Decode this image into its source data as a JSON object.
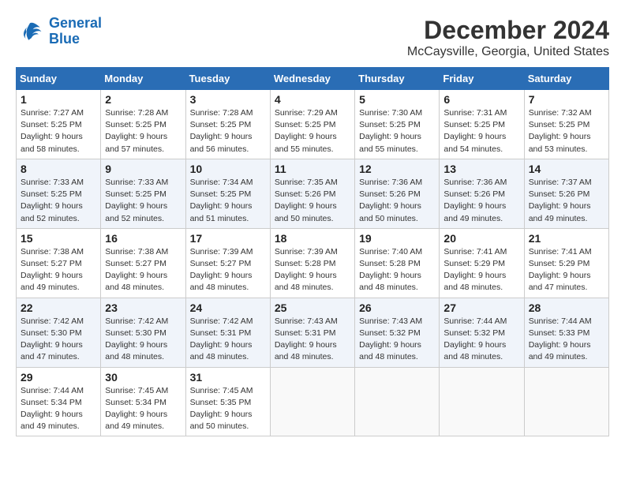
{
  "logo": {
    "line1": "General",
    "line2": "Blue"
  },
  "title": "December 2024",
  "subtitle": "McCaysville, Georgia, United States",
  "header_days": [
    "Sunday",
    "Monday",
    "Tuesday",
    "Wednesday",
    "Thursday",
    "Friday",
    "Saturday"
  ],
  "weeks": [
    [
      {
        "day": 1,
        "lines": [
          "Sunrise: 7:27 AM",
          "Sunset: 5:25 PM",
          "Daylight: 9 hours",
          "and 58 minutes."
        ]
      },
      {
        "day": 2,
        "lines": [
          "Sunrise: 7:28 AM",
          "Sunset: 5:25 PM",
          "Daylight: 9 hours",
          "and 57 minutes."
        ]
      },
      {
        "day": 3,
        "lines": [
          "Sunrise: 7:28 AM",
          "Sunset: 5:25 PM",
          "Daylight: 9 hours",
          "and 56 minutes."
        ]
      },
      {
        "day": 4,
        "lines": [
          "Sunrise: 7:29 AM",
          "Sunset: 5:25 PM",
          "Daylight: 9 hours",
          "and 55 minutes."
        ]
      },
      {
        "day": 5,
        "lines": [
          "Sunrise: 7:30 AM",
          "Sunset: 5:25 PM",
          "Daylight: 9 hours",
          "and 55 minutes."
        ]
      },
      {
        "day": 6,
        "lines": [
          "Sunrise: 7:31 AM",
          "Sunset: 5:25 PM",
          "Daylight: 9 hours",
          "and 54 minutes."
        ]
      },
      {
        "day": 7,
        "lines": [
          "Sunrise: 7:32 AM",
          "Sunset: 5:25 PM",
          "Daylight: 9 hours",
          "and 53 minutes."
        ]
      }
    ],
    [
      {
        "day": 8,
        "lines": [
          "Sunrise: 7:33 AM",
          "Sunset: 5:25 PM",
          "Daylight: 9 hours",
          "and 52 minutes."
        ]
      },
      {
        "day": 9,
        "lines": [
          "Sunrise: 7:33 AM",
          "Sunset: 5:25 PM",
          "Daylight: 9 hours",
          "and 52 minutes."
        ]
      },
      {
        "day": 10,
        "lines": [
          "Sunrise: 7:34 AM",
          "Sunset: 5:25 PM",
          "Daylight: 9 hours",
          "and 51 minutes."
        ]
      },
      {
        "day": 11,
        "lines": [
          "Sunrise: 7:35 AM",
          "Sunset: 5:26 PM",
          "Daylight: 9 hours",
          "and 50 minutes."
        ]
      },
      {
        "day": 12,
        "lines": [
          "Sunrise: 7:36 AM",
          "Sunset: 5:26 PM",
          "Daylight: 9 hours",
          "and 50 minutes."
        ]
      },
      {
        "day": 13,
        "lines": [
          "Sunrise: 7:36 AM",
          "Sunset: 5:26 PM",
          "Daylight: 9 hours",
          "and 49 minutes."
        ]
      },
      {
        "day": 14,
        "lines": [
          "Sunrise: 7:37 AM",
          "Sunset: 5:26 PM",
          "Daylight: 9 hours",
          "and 49 minutes."
        ]
      }
    ],
    [
      {
        "day": 15,
        "lines": [
          "Sunrise: 7:38 AM",
          "Sunset: 5:27 PM",
          "Daylight: 9 hours",
          "and 49 minutes."
        ]
      },
      {
        "day": 16,
        "lines": [
          "Sunrise: 7:38 AM",
          "Sunset: 5:27 PM",
          "Daylight: 9 hours",
          "and 48 minutes."
        ]
      },
      {
        "day": 17,
        "lines": [
          "Sunrise: 7:39 AM",
          "Sunset: 5:27 PM",
          "Daylight: 9 hours",
          "and 48 minutes."
        ]
      },
      {
        "day": 18,
        "lines": [
          "Sunrise: 7:39 AM",
          "Sunset: 5:28 PM",
          "Daylight: 9 hours",
          "and 48 minutes."
        ]
      },
      {
        "day": 19,
        "lines": [
          "Sunrise: 7:40 AM",
          "Sunset: 5:28 PM",
          "Daylight: 9 hours",
          "and 48 minutes."
        ]
      },
      {
        "day": 20,
        "lines": [
          "Sunrise: 7:41 AM",
          "Sunset: 5:29 PM",
          "Daylight: 9 hours",
          "and 48 minutes."
        ]
      },
      {
        "day": 21,
        "lines": [
          "Sunrise: 7:41 AM",
          "Sunset: 5:29 PM",
          "Daylight: 9 hours",
          "and 47 minutes."
        ]
      }
    ],
    [
      {
        "day": 22,
        "lines": [
          "Sunrise: 7:42 AM",
          "Sunset: 5:30 PM",
          "Daylight: 9 hours",
          "and 47 minutes."
        ]
      },
      {
        "day": 23,
        "lines": [
          "Sunrise: 7:42 AM",
          "Sunset: 5:30 PM",
          "Daylight: 9 hours",
          "and 48 minutes."
        ]
      },
      {
        "day": 24,
        "lines": [
          "Sunrise: 7:42 AM",
          "Sunset: 5:31 PM",
          "Daylight: 9 hours",
          "and 48 minutes."
        ]
      },
      {
        "day": 25,
        "lines": [
          "Sunrise: 7:43 AM",
          "Sunset: 5:31 PM",
          "Daylight: 9 hours",
          "and 48 minutes."
        ]
      },
      {
        "day": 26,
        "lines": [
          "Sunrise: 7:43 AM",
          "Sunset: 5:32 PM",
          "Daylight: 9 hours",
          "and 48 minutes."
        ]
      },
      {
        "day": 27,
        "lines": [
          "Sunrise: 7:44 AM",
          "Sunset: 5:32 PM",
          "Daylight: 9 hours",
          "and 48 minutes."
        ]
      },
      {
        "day": 28,
        "lines": [
          "Sunrise: 7:44 AM",
          "Sunset: 5:33 PM",
          "Daylight: 9 hours",
          "and 49 minutes."
        ]
      }
    ],
    [
      {
        "day": 29,
        "lines": [
          "Sunrise: 7:44 AM",
          "Sunset: 5:34 PM",
          "Daylight: 9 hours",
          "and 49 minutes."
        ]
      },
      {
        "day": 30,
        "lines": [
          "Sunrise: 7:45 AM",
          "Sunset: 5:34 PM",
          "Daylight: 9 hours",
          "and 49 minutes."
        ]
      },
      {
        "day": 31,
        "lines": [
          "Sunrise: 7:45 AM",
          "Sunset: 5:35 PM",
          "Daylight: 9 hours",
          "and 50 minutes."
        ]
      },
      null,
      null,
      null,
      null
    ]
  ]
}
